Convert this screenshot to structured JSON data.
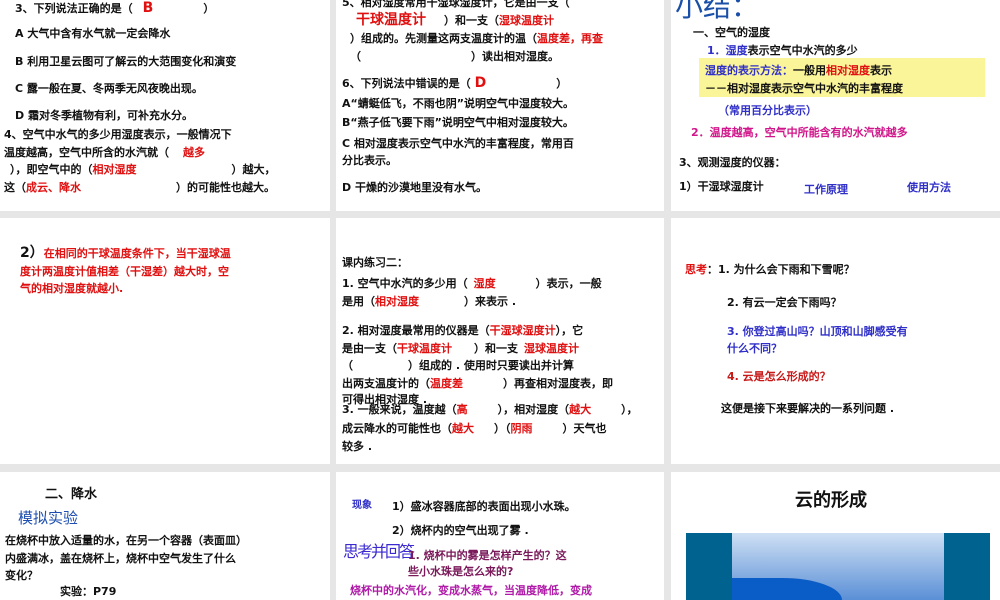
{
  "slides": {
    "s1": {
      "q3": "3、下列说法正确的是（",
      "q3_answer": "B",
      "q3_close": "）",
      "a": "A 大气中含有水气就一定会降水",
      "b": "B 利用卫星云图可了解云的大范围变化和演变",
      "c": "C 露一般在夏、冬两季无风夜晚出现。",
      "d": "D 霜对冬季植物有利，可补充水分。",
      "q4_l1": "4、空气中水气的多少用湿度表示，一般情况下",
      "q4_l2": "温度越高，空气中所含的水汽就（",
      "q4_ans1": "越多",
      "q4_l3a": "），即空气中的（",
      "q4_ans2": "相对湿度",
      "q4_l3b": "）越大，",
      "q4_l4a": "这（",
      "q4_ans3": "成云、降水",
      "q4_l4b": "）的可能性也越大。"
    },
    "s2": {
      "q5_l1": "5、相对湿度常用干湿球湿度计，它是由一支（",
      "q5_ans1": "干球温度计",
      "q5_l2": "）和一支（",
      "q5_ans2": "湿球温度计",
      "q5_l3": "）组成的。先测量这两支温度计的温（",
      "q5_ans3": "温度差，再查",
      "q5_l4a": "（",
      "q5_l4b": "）读出相对湿度。",
      "q6": "6、下列说法中错误的是（",
      "q6_answer": "D",
      "q6_close": "）",
      "a": "A“蜻蜓低飞，不雨也阴”说明空气中湿度较大。",
      "b": "B“燕子低飞要下雨”说明空气中相对湿度较大。",
      "c1": "C 相对湿度表示空气中水汽的丰富程度，常用百",
      "c2": "分比表示。",
      "d": "D 干燥的沙漠地里没有水气。"
    },
    "s3": {
      "title": "小结：",
      "h1": "一、空气的湿度",
      "p1_key": "1．湿度",
      "p1_rest": "表示空气中水汽的多少",
      "box_l1_a": "湿度的表示方法：",
      "box_l1_b": "一般用",
      "box_l1_c": "相对湿度",
      "box_l1_d": "表示",
      "box_l2": "－－相对湿度表示空气中水汽的丰富程度",
      "note": "（常用百分比表示）",
      "p2": "2．温度越高，空气中所能含有的水汽就越多",
      "h3": "3、观测湿度的仪器：",
      "i1": "1）干湿球湿度计",
      "link1": "工作原理",
      "link2": "使用方法"
    },
    "s4": {
      "prefix": "2）",
      "l1": "在相同的干球温度条件下，当干湿球温",
      "l2": "度计两温度计值相差（干湿差）越大时，空",
      "l3": "气的相对湿度就越小."
    },
    "s5": {
      "title": "课内练习二：",
      "q1_l1a": "1. 空气中水汽的多少用（",
      "q1_ans1": "湿度",
      "q1_l1b": "）表示，一般",
      "q1_l2a": "是用（",
      "q1_ans2": "相对湿度",
      "q1_l2b": "）来表示 .",
      "q2_l1a": "2. 相对湿度最常用的仪器是（",
      "q2_ans1": "干湿球湿度计",
      "q2_l1b": "），它",
      "q2_l2a": "是由一支（",
      "q2_ans2": "干球温度计",
      "q2_l2b": "）和一支",
      "q2_ans3": "湿球温度计",
      "q2_l3": "（　　　　　）组成的 . 使用时只要读出并计算",
      "q2_l4a": "出两支温度计的（",
      "q2_ans4": "温度差",
      "q2_l4b": "）再查相对湿度表，即",
      "q2_l5": "可得出相对湿度 .",
      "q3_l1a": "3. 一般来说，温度越（",
      "q3_ans1": "高",
      "q3_l1b": "），相对湿度（",
      "q3_ans2": "越大",
      "q3_l1c": "），",
      "q3_l2a": "成云降水的可能性也（",
      "q3_ans3": "越大",
      "q3_l2b": "）（",
      "q3_ans4": "阴雨",
      "q3_l2c": "）天气也",
      "q3_l3": "较多 ."
    },
    "s6": {
      "label": "思考",
      "q1": "：1. 为什么会下雨和下雪呢？",
      "q2": "2. 有云一定会下雨吗？",
      "q3_l1": "3. 你登过高山吗？山顶和山脚感受有",
      "q3_l2": "什么不同？",
      "q4": "4. 云是怎么形成的？",
      "summary": "这便是接下来要解决的一系列问题 ."
    },
    "s7": {
      "h": "二、降水",
      "sub": "模拟实验",
      "l1": "在烧杯中放入适量的水，在另一个容器（表面皿）",
      "l2": "内盛满冰，盖在烧杯上，烧杯中空气发生了什么",
      "l3": "变化？",
      "l4": "实验：P79"
    },
    "s8": {
      "label": "现象",
      "o1": "1）盛冰容器底部的表面出现小水珠。",
      "o2": "2）烧杯内的空气出现了雾 .",
      "think": "思考并回答",
      "q1_l1": "1. 烧杯中的雾是怎样产生的？这",
      "q1_l2": "些小水珠是怎么来的?",
      "ans_cut": "烧杯中的水汽化，变成水蒸气，当温度降低，变成"
    },
    "s9": {
      "title": "云的形成"
    }
  }
}
